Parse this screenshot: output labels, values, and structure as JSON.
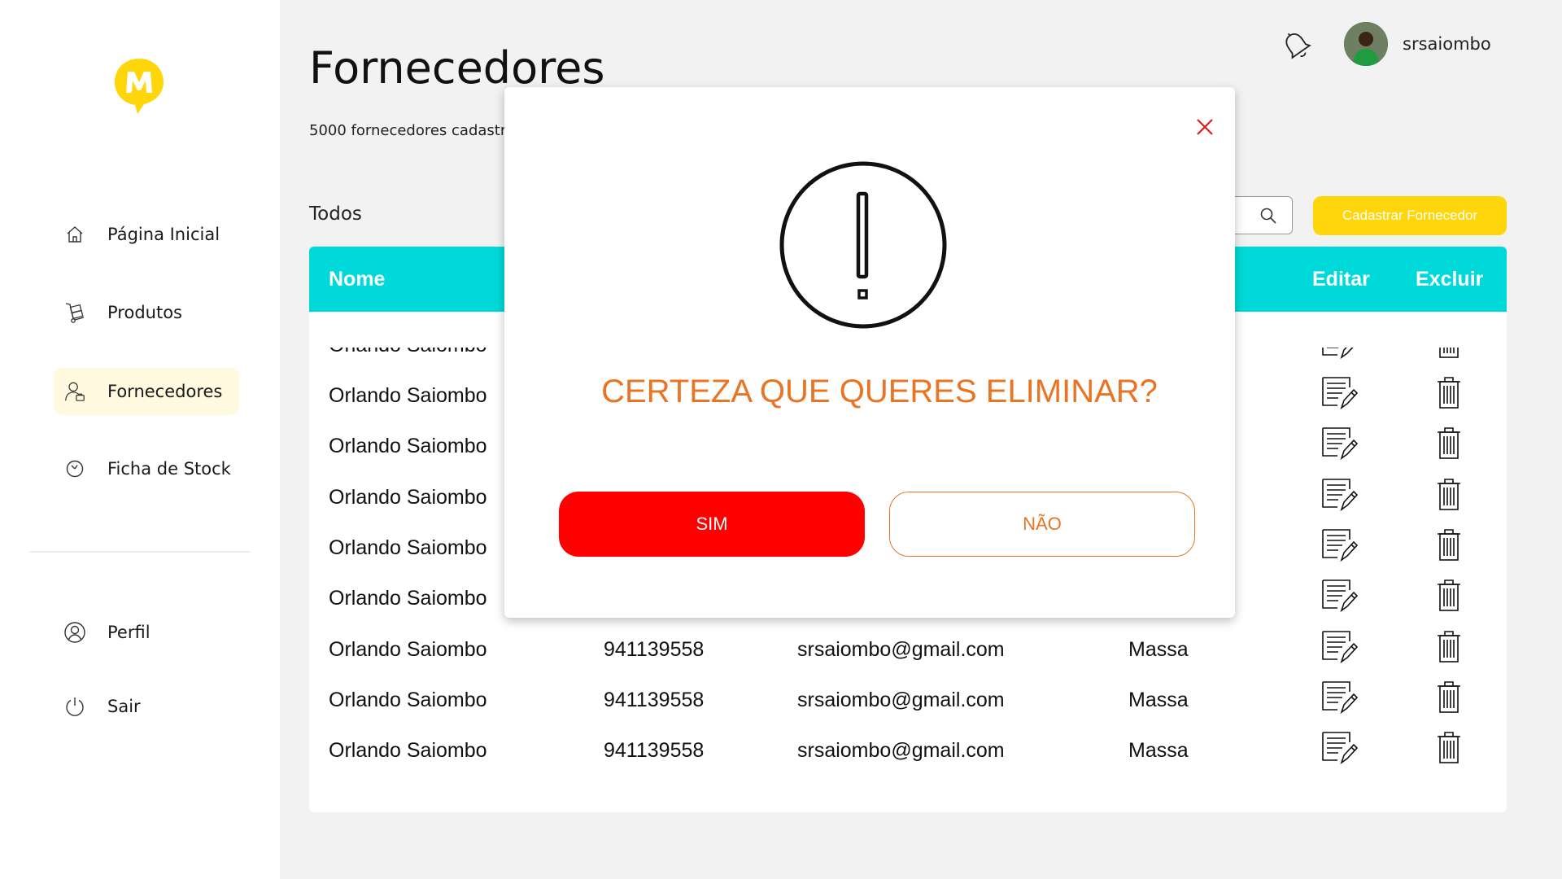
{
  "sidebar": {
    "items": [
      {
        "label": "Página Inicial",
        "icon": "home-icon"
      },
      {
        "label": "Produtos",
        "icon": "hand-truck-icon"
      },
      {
        "label": "Fornecedores",
        "icon": "supplier-icon"
      },
      {
        "label": "Ficha de Stock",
        "icon": "clock-icon"
      }
    ],
    "bottom_items": [
      {
        "label": "Perfil",
        "icon": "user-circle-icon"
      },
      {
        "label": "Sair",
        "icon": "power-icon"
      }
    ]
  },
  "header": {
    "title": "Fornecedores",
    "subtitle": "5000 fornecedores cadastra",
    "username": "srsaiombo"
  },
  "toolbar": {
    "filter_label": "Todos",
    "cadastrar_label": "Cadastrar  Fornecedor"
  },
  "table": {
    "headers": {
      "nome": "Nome",
      "editar": "Editar",
      "excluir": "Excluir"
    },
    "rows": [
      {
        "nome": "Orlando Saiombo",
        "telefone": "",
        "email": "",
        "tipo": ""
      },
      {
        "nome": "Orlando Saiombo",
        "telefone": "",
        "email": "",
        "tipo": ""
      },
      {
        "nome": "Orlando Saiombo",
        "telefone": "",
        "email": "",
        "tipo": ""
      },
      {
        "nome": "Orlando Saiombo",
        "telefone": "",
        "email": "",
        "tipo": ""
      },
      {
        "nome": "Orlando Saiombo",
        "telefone": "",
        "email": "",
        "tipo": ""
      },
      {
        "nome": "Orlando Saiombo",
        "telefone": "",
        "email": "",
        "tipo": ""
      },
      {
        "nome": "Orlando Saiombo",
        "telefone": "941139558",
        "email": "srsaiombo@gmail.com",
        "tipo": "Massa"
      },
      {
        "nome": "Orlando Saiombo",
        "telefone": "941139558",
        "email": "srsaiombo@gmail.com",
        "tipo": "Massa"
      },
      {
        "nome": "Orlando Saiombo",
        "telefone": "941139558",
        "email": "srsaiombo@gmail.com",
        "tipo": "Massa"
      }
    ]
  },
  "modal": {
    "question": "CERTEZA QUE QUERES ELIMINAR?",
    "confirm_label": "SIM",
    "cancel_label": "NÃO"
  },
  "colors": {
    "brand_yellow": "#ffd60a",
    "table_header": "#00d9d9",
    "danger_red": "#ff0000",
    "orange": "#e87424"
  }
}
